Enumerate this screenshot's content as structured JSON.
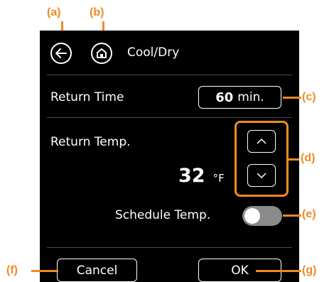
{
  "colors": {
    "accent": "#f08a24",
    "screen_bg": "#000000",
    "text": "#ffffff",
    "toggle_track": "#8a8a8a"
  },
  "header": {
    "back_icon": "arrow-left-icon",
    "home_icon": "home-icon",
    "title": "Cool/Dry"
  },
  "return_time": {
    "label": "Return Time",
    "value": "60",
    "unit": "min."
  },
  "return_temp": {
    "label": "Return Temp.",
    "value": "32",
    "unit": "°F",
    "up_icon": "chevron-up-icon",
    "down_icon": "chevron-down-icon"
  },
  "schedule_temp": {
    "label": "Schedule Temp.",
    "enabled": false
  },
  "footer": {
    "cancel_label": "Cancel",
    "ok_label": "OK"
  },
  "callouts": {
    "a": "(a)",
    "b": "(b)",
    "c": "(c)",
    "d": "(d)",
    "e": "(e)",
    "f": "(f)",
    "g": "(g)"
  }
}
